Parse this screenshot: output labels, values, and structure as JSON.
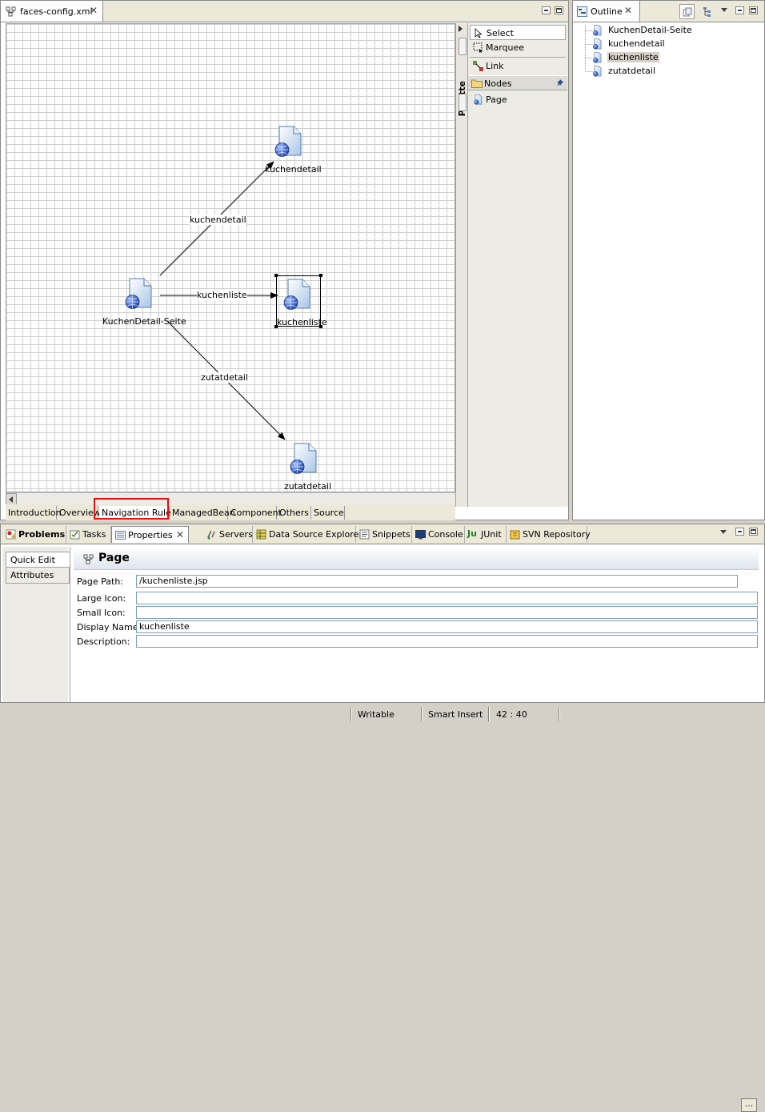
{
  "editor": {
    "tab_title": "faces-config.xml",
    "palette_title": "Palette",
    "palette_items": [
      {
        "label": "Select",
        "icon": "arrow-cursor-icon"
      },
      {
        "label": "Marquee",
        "icon": "marquee-icon"
      },
      {
        "label": "Link",
        "icon": "link-icon"
      }
    ],
    "palette_drawer": {
      "label": "Nodes",
      "icon": "folder-icon"
    },
    "palette_nodes": [
      {
        "label": "Page",
        "icon": "page-icon"
      }
    ],
    "diagram": {
      "nodes": {
        "source": "KuchenDetail-Seite",
        "top": "kuchendetail",
        "middle": "kuchenliste",
        "bottom": "zutatdetail"
      },
      "edges": {
        "top": "kuchendetail",
        "middle": "kuchenliste",
        "bottom": "zutatdetail"
      }
    },
    "bottom_tabs": [
      "Introduction",
      "Overview",
      "Navigation Rule",
      "ManagedBean",
      "Component",
      "Others",
      "Source"
    ]
  },
  "outline": {
    "tab_title": "Outline",
    "items": [
      "KuchenDetail-Seite",
      "kuchendetail",
      "kuchenliste",
      "zutatdetail"
    ],
    "selected_item": "kuchenliste"
  },
  "views": {
    "tabs": [
      "Problems",
      "Tasks",
      "Properties",
      "Servers",
      "Data Source Explorer",
      "Snippets",
      "Console",
      "JUnit",
      "SVN Repository"
    ],
    "active_tab": "Properties"
  },
  "properties": {
    "side_tabs": [
      "Quick Edit",
      "Attributes"
    ],
    "header": "Page",
    "fields": [
      {
        "label": "Page Path:",
        "value": "/kuchenliste.jsp"
      },
      {
        "label": "Large Icon:",
        "value": ""
      },
      {
        "label": "Small Icon:",
        "value": ""
      },
      {
        "label": "Display Name:",
        "value": "kuchenliste"
      },
      {
        "label": "Description:",
        "value": ""
      }
    ],
    "browse_label": "..."
  },
  "statusbar": {
    "writable": "Writable",
    "insert_mode": "Smart Insert",
    "position": "42 : 40"
  },
  "colors": {
    "highlight_border": "#e81010",
    "chrome": "#d4d0c8",
    "selection": "#d4d0c8"
  }
}
